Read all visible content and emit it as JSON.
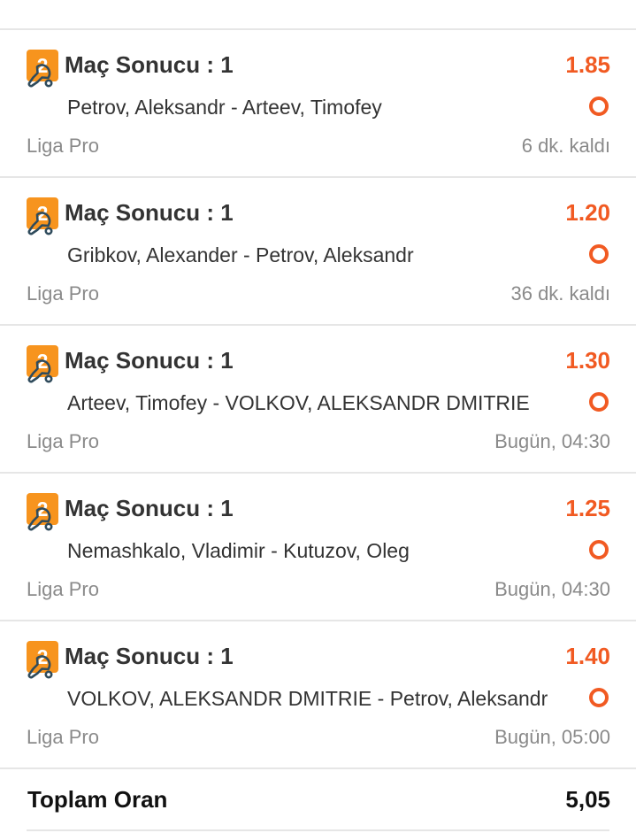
{
  "colors": {
    "accent": "#f15a22",
    "badge": "#f7941e",
    "text": "#333333",
    "muted": "#8a8a8a",
    "divider": "#e6e6e6",
    "sport_icon": "#2f4b5c"
  },
  "bets": [
    {
      "badge": "2",
      "market": "Maç Sonucu : 1",
      "odd": "1.85",
      "sport_icon": "table-tennis-icon",
      "match": "Petrov, Aleksandr - Arteev, Timofey",
      "status_icon": "pending-circle-icon",
      "league": "Liga Pro",
      "time": "6 dk. kaldı"
    },
    {
      "badge": "2",
      "market": "Maç Sonucu : 1",
      "odd": "1.20",
      "sport_icon": "table-tennis-icon",
      "match": "Gribkov, Alexander - Petrov, Aleksandr",
      "status_icon": "pending-circle-icon",
      "league": "Liga Pro",
      "time": "36 dk. kaldı"
    },
    {
      "badge": "2",
      "market": "Maç Sonucu : 1",
      "odd": "1.30",
      "sport_icon": "table-tennis-icon",
      "match": "Arteev, Timofey - VOLKOV, ALEKSANDR DMITRIE",
      "status_icon": "pending-circle-icon",
      "league": "Liga Pro",
      "time": "Bugün, 04:30"
    },
    {
      "badge": "2",
      "market": "Maç Sonucu : 1",
      "odd": "1.25",
      "sport_icon": "table-tennis-icon",
      "match": "Nemashkalo, Vladimir - Kutuzov, Oleg",
      "status_icon": "pending-circle-icon",
      "league": "Liga Pro",
      "time": "Bugün, 04:30"
    },
    {
      "badge": "2",
      "market": "Maç Sonucu : 1",
      "odd": "1.40",
      "sport_icon": "table-tennis-icon",
      "match": "VOLKOV, ALEKSANDR DMITRIE - Petrov, Aleksandr",
      "status_icon": "pending-circle-icon",
      "league": "Liga Pro",
      "time": "Bugün, 05:00"
    }
  ],
  "total": {
    "label": "Toplam Oran",
    "value": "5,05"
  }
}
